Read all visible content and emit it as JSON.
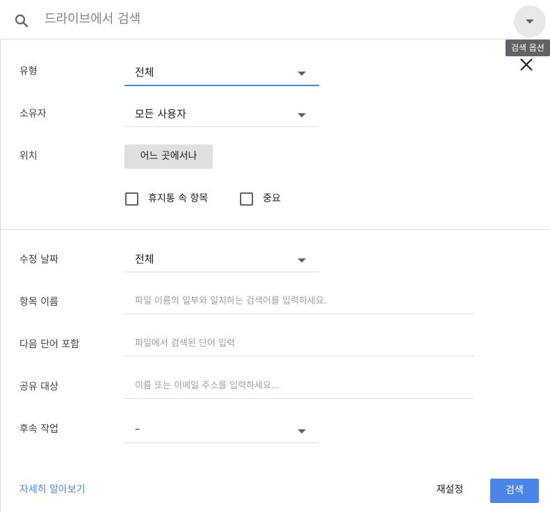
{
  "search": {
    "placeholder": "드라이브에서 검색",
    "options_tooltip": "검색 옵션"
  },
  "filters": {
    "type": {
      "label": "유형",
      "value": "전체"
    },
    "owner": {
      "label": "소유자",
      "value": "모든 사용자"
    },
    "location": {
      "label": "위치",
      "button": "어느 곳에서나"
    },
    "checkboxes": [
      {
        "label": "휴지통 속 항목",
        "checked": false
      },
      {
        "label": "중요",
        "checked": false
      }
    ],
    "modified": {
      "label": "수정 날짜",
      "value": "전체"
    },
    "item_name": {
      "label": "항목 이름",
      "placeholder": "파일 이름의 일부와 일치하는 검색어를 입력하세요."
    },
    "has_words": {
      "label": "다음 단어 포함",
      "placeholder": "파일에서 검색된 단어 입력"
    },
    "shared_with": {
      "label": "공유 대상",
      "placeholder": "이름 또는 이메일 주소를 입력하세요..."
    },
    "follow_up": {
      "label": "후속 작업",
      "value": "–"
    }
  },
  "footer": {
    "learn_more": "자세히 알아보기",
    "reset": "재설정",
    "search": "검색"
  },
  "colors": {
    "accent": "#4a86e8",
    "tooltip_bg": "#5f6368"
  }
}
